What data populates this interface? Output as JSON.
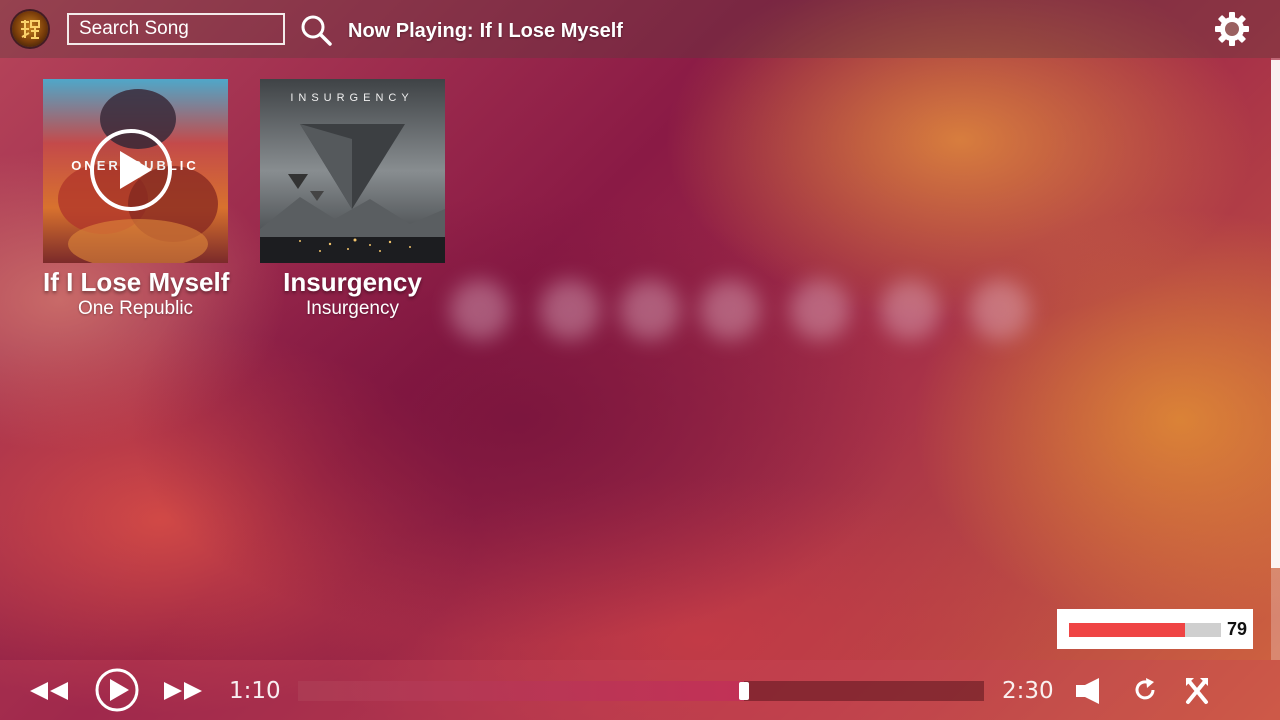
{
  "header": {
    "search_placeholder": "Search Song",
    "now_playing_label": "Now Playing:",
    "now_playing_title": "If I Lose Myself"
  },
  "songs": [
    {
      "title": "If I Lose Myself",
      "artist": "One Republic",
      "art_text": "ONEREPUBLIC",
      "playing": true
    },
    {
      "title": "Insurgency",
      "artist": "Insurgency",
      "art_text": "INSURGENCY",
      "playing": false
    }
  ],
  "player": {
    "current_time": "1:10",
    "total_time": "2:30",
    "progress": 0.65,
    "volume": "79",
    "volume_fraction": 0.76
  },
  "icons": {
    "logo": "app-logo",
    "search": "search-icon",
    "settings": "gear-icon",
    "prev": "rewind-icon",
    "play": "play-icon",
    "next": "fast-forward-icon",
    "volume": "speaker-icon",
    "repeat": "repeat-icon",
    "shuffle": "shuffle-icon"
  },
  "colors": {
    "volume_fill": "#ef4444",
    "volume_track": "#cfcfcf",
    "progress_handle": "#ffffff"
  }
}
